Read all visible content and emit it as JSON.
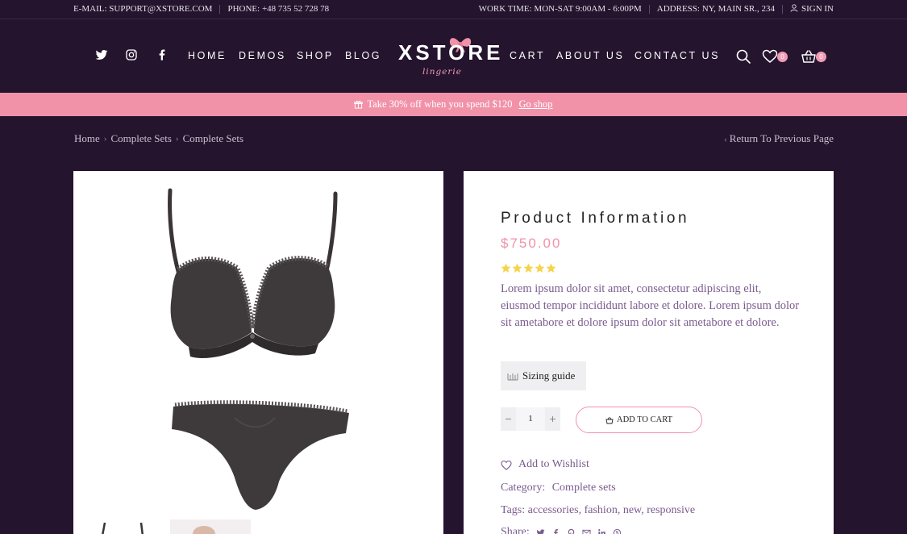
{
  "topbar": {
    "email": "E-MAIL: SUPPORT@XSTORE.COM",
    "phone": "PHONE: +48 735 52 728 78",
    "work_time": "WORK TIME: MON-SAT 9:00AM - 6:00PM",
    "address": "ADDRESS: NY, MAIN SR., 234",
    "sign_in": "SIGN IN"
  },
  "nav": {
    "left": [
      "HOME",
      "DEMOS",
      "SHOP",
      "BLOG"
    ],
    "right": [
      "CART",
      "ABOUT US",
      "CONTACT US"
    ]
  },
  "logo": {
    "text": "XSTORE",
    "sub": "lingerie"
  },
  "header_icons": {
    "wishlist_count": "0",
    "cart_count": "0"
  },
  "promo": {
    "text": "Take 30% off when you spend $120",
    "link": "Go shop"
  },
  "breadcrumb": [
    "Home",
    "Complete Sets",
    "Complete Sets"
  ],
  "back_link": "Return To Previous Page",
  "product": {
    "title": "Product Information",
    "price": "$750.00",
    "rating": 5,
    "description": "Lorem ipsum dolor sit amet, consectetur adipiscing elit, eiusmod tempor incididunt labore et dolore. Lorem ipsum dolor sit ametabore et dolore ipsum dolor sit ametabore et dolore.",
    "sizing_guide": "Sizing guide",
    "quantity": "1",
    "qty_minus": "−",
    "qty_plus": "+",
    "add_to_cart": "ADD TO CART",
    "add_to_wishlist": "Add to Wishlist",
    "category_label": "Category:",
    "category_value": "Complete sets",
    "tags_label": "Tags:",
    "tags": "accessories, fashion, new, responsive",
    "share_label": "Share:"
  },
  "colors": {
    "background": "#24142e",
    "accent": "#f192a9",
    "star": "#f5d44c",
    "text": "#7a5c8f"
  }
}
